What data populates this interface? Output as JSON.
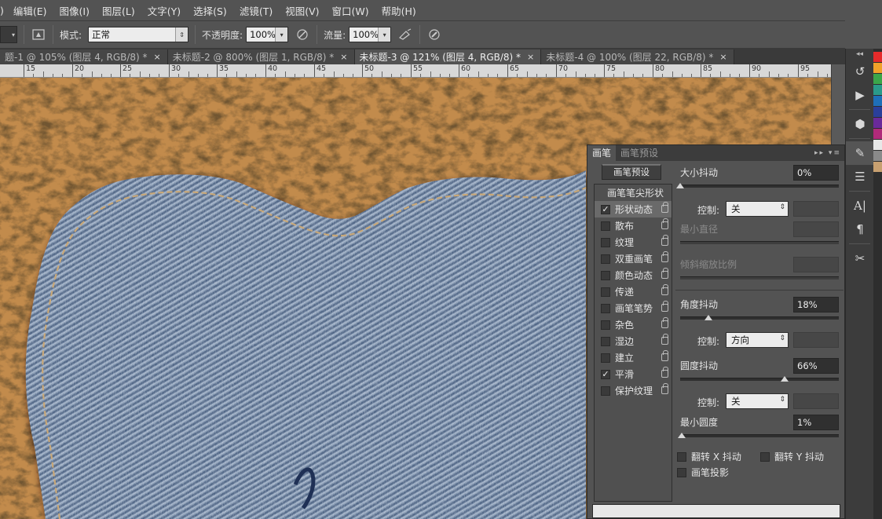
{
  "menu": [
    "编辑(E)",
    "图像(I)",
    "图层(L)",
    "文字(Y)",
    "选择(S)",
    "滤镜(T)",
    "视图(V)",
    "窗口(W)",
    "帮助(H)"
  ],
  "options": {
    "mode_label": "模式:",
    "mode_value": "正常",
    "opacity_label": "不透明度:",
    "opacity_value": "100%",
    "flow_label": "流量:",
    "flow_value": "100%"
  },
  "tabs": [
    {
      "label": "题-1 @ 105% (图层 4, RGB/8) *",
      "active": false
    },
    {
      "label": "未标题-2 @ 800% (图层 1, RGB/8) *",
      "active": false
    },
    {
      "label": "未标题-3 @ 121% (图层 4, RGB/8) *",
      "active": true
    },
    {
      "label": "未标题-4 @ 100% (图层 22, RGB/8) *",
      "active": false
    }
  ],
  "tab_close": "×",
  "ruler_ticks": [
    "15",
    "20",
    "25",
    "30",
    "35",
    "40",
    "45",
    "50",
    "55",
    "60",
    "65",
    "70",
    "75",
    "80",
    "85",
    "90",
    "95"
  ],
  "brush_panel": {
    "tabs": [
      "画笔",
      "画笔预设"
    ],
    "preset_button": "画笔预设",
    "tip_shape": "画笔笔尖形状",
    "items": [
      {
        "label": "形状动态",
        "checked": true,
        "selected": true
      },
      {
        "label": "散布",
        "checked": false
      },
      {
        "label": "纹理",
        "checked": false
      },
      {
        "label": "双重画笔",
        "checked": false
      },
      {
        "label": "颜色动态",
        "checked": false
      },
      {
        "label": "传递",
        "checked": false
      },
      {
        "label": "画笔笔势",
        "checked": false
      },
      {
        "label": "杂色",
        "checked": false
      },
      {
        "label": "湿边",
        "checked": false
      },
      {
        "label": "建立",
        "checked": false
      },
      {
        "label": "平滑",
        "checked": true
      },
      {
        "label": "保护纹理",
        "checked": false
      }
    ],
    "size_jitter_label": "大小抖动",
    "size_jitter_value": "0%",
    "control_label": "控制:",
    "control1": "关",
    "min_diameter_label": "最小直径",
    "tilt_scale_label": "倾斜缩放比例",
    "angle_jitter_label": "角度抖动",
    "angle_jitter_value": "18%",
    "control2": "方向",
    "roundness_jitter_label": "圆度抖动",
    "roundness_jitter_value": "66%",
    "control3": "关",
    "min_roundness_label": "最小圆度",
    "min_roundness_value": "1%",
    "flip_x_label": "翻转 X 抖动",
    "flip_y_label": "翻转 Y 抖动",
    "brush_projection_label": "画笔投影"
  },
  "slider_levels": {
    "size_jitter": 0,
    "angle_jitter": 18,
    "roundness_jitter": 66,
    "min_roundness": 1
  },
  "swatch_colors": [
    "#e52b2b",
    "#f0a22a",
    "#3aa64a",
    "#2a9a8a",
    "#1e6fb8",
    "#2a3f9a",
    "#6a2a9a",
    "#b02a7a",
    "#e8e8e8",
    "#8a8a8a",
    "#c8a070"
  ],
  "icons": [
    "history-icon",
    "play-icon",
    "cube-icon",
    "brush-icon",
    "settings-sliders-icon",
    "character-icon",
    "paragraph-icon",
    "tools-icon"
  ]
}
